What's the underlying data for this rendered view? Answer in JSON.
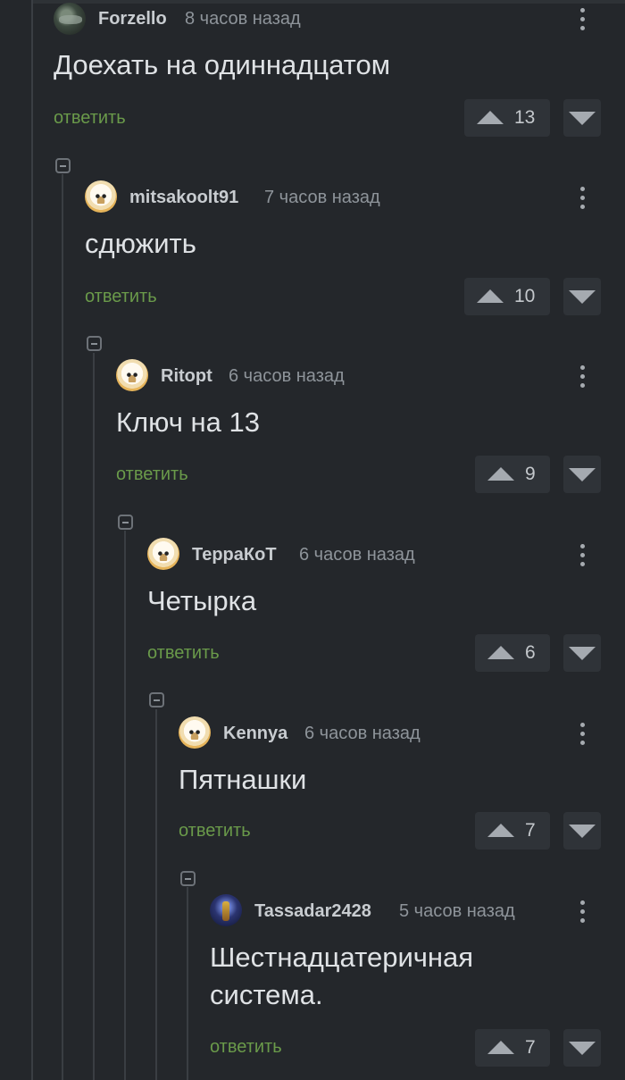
{
  "reply_label": "ответить",
  "comments": [
    {
      "username": "Forzello",
      "time": "8 часов назад",
      "avatar": "photo-avatar",
      "text": "Доехать на одиннадцатом",
      "rating": "13"
    },
    {
      "username": "mitsakoolt91",
      "time": "7 часов назад",
      "avatar": "dog-avatar",
      "text": "сдюжить",
      "rating": "10"
    },
    {
      "username": "Ritopt",
      "time": "6 часов назад",
      "avatar": "dog-avatar",
      "text": "Ключ на 13",
      "rating": "9"
    },
    {
      "username": "ТеррaКоТ",
      "time": "6 часов назад",
      "avatar": "dog-avatar",
      "text": "Четырка",
      "rating": "6"
    },
    {
      "username": "Kennya",
      "time": "6 часов назад",
      "avatar": "dog-avatar",
      "text": "Пятнашки",
      "rating": "7"
    },
    {
      "username": "Tassadar2428",
      "time": "5 часов назад",
      "avatar": "warrior-avatar",
      "text": "Шестнадцатеричная система.",
      "rating": "7"
    }
  ]
}
